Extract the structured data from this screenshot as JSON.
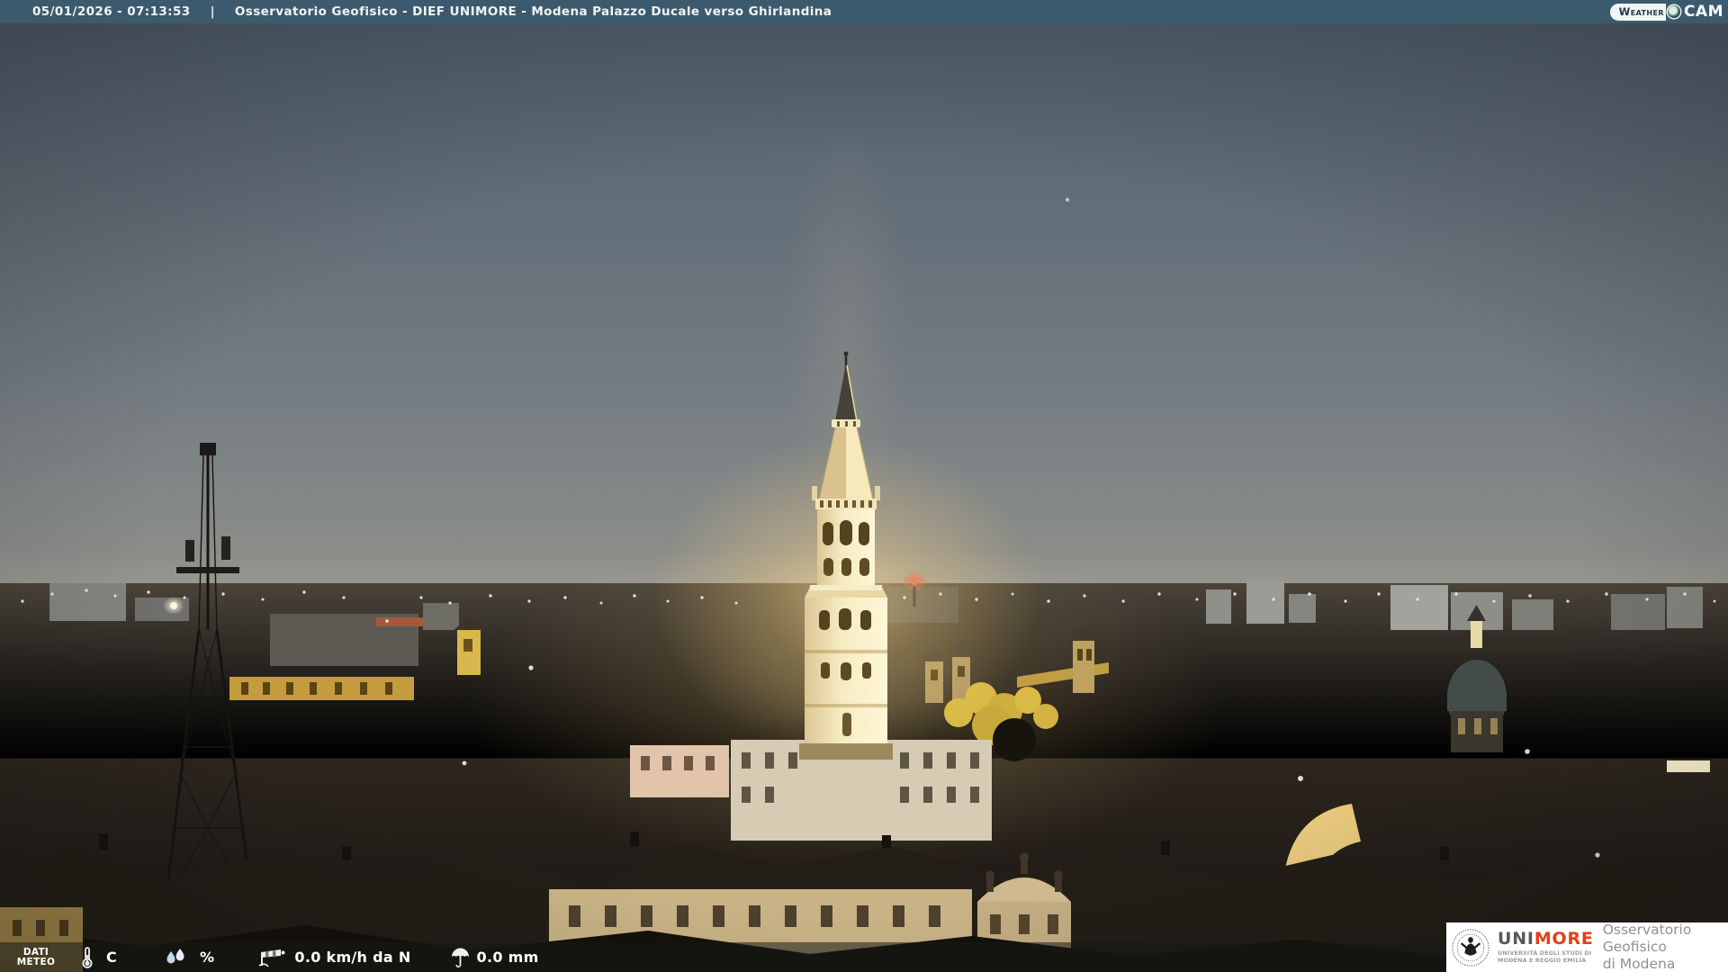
{
  "header": {
    "datetime": "05/01/2026 - 07:13:53",
    "separator": "|",
    "title": "Osservatorio Geofisico - DIEF UNIMORE - Modena Palazzo Ducale verso Ghirlandina"
  },
  "weathercam": {
    "weather": "Weather",
    "cam": "CAM"
  },
  "meteo": {
    "label_line1": "DATI",
    "label_line2": "METEO",
    "temperature": {
      "value": "",
      "unit": "C"
    },
    "humidity": {
      "value": "",
      "unit": "%"
    },
    "wind": {
      "value": "0.0 km/h da N"
    },
    "rain": {
      "value": "0.0 mm"
    }
  },
  "unimore": {
    "brand_uni": "UNI",
    "brand_more": "MORE",
    "subtitle_line1": "UNIVERSITÀ DEGLI STUDI DI",
    "subtitle_line2": "MODENA E REGGIO EMILIA",
    "org_line1": "Osservatorio Geofisico",
    "org_line2": "di Modena"
  },
  "colors": {
    "topbar": "#3c5a6e",
    "text": "#f2f4f1",
    "brand_red": "#e63e17"
  },
  "scene": {
    "description": "Pre-dawn webcam view over Modena rooftops with the illuminated Ghirlandina tower at center, a lattice antenna mast at left, church dome at right and scattered city lights"
  }
}
